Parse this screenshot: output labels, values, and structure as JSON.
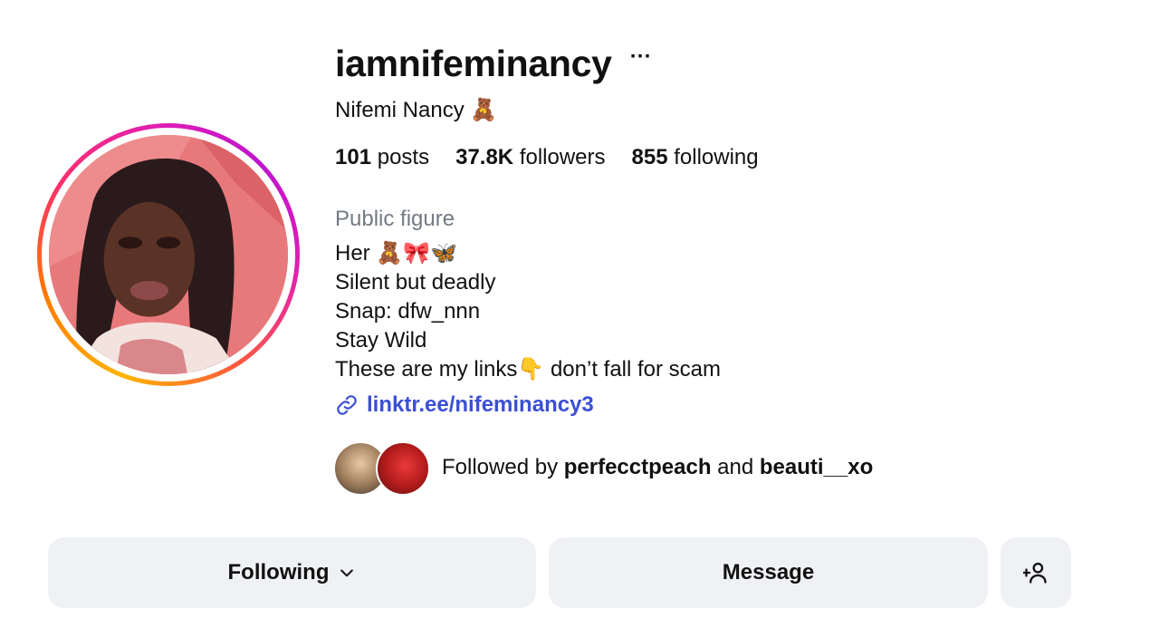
{
  "profile": {
    "username": "iamnifeminancy",
    "more_label": "···",
    "full_name": "Nifemi Nancy 🧸",
    "category": "Public figure"
  },
  "stats": {
    "posts_count": "101",
    "posts_label": "posts",
    "followers_count": "37.8K",
    "followers_label": "followers",
    "following_count": "855",
    "following_label": "following"
  },
  "bio": {
    "lines": [
      "Her 🧸🎀🦋",
      "Silent but deadly",
      "Snap: dfw_nnn",
      "Stay Wild",
      "These are my links👇 don’t fall for scam"
    ],
    "link": "linktr.ee/nifeminancy3"
  },
  "followed_by": {
    "prefix": "Followed by ",
    "user1": "perfecctpeach",
    "conjunction": " and ",
    "user2": "beauti__xo"
  },
  "actions": {
    "following_label": "Following",
    "message_label": "Message"
  },
  "icons": {
    "more": "more-horizontal-icon",
    "link": "link-icon",
    "chevron": "chevron-down-icon",
    "add_user": "add-user-icon"
  },
  "colors": {
    "link": "#3b4fd6",
    "category": "#737a83",
    "button_bg": "#eff1f4"
  }
}
